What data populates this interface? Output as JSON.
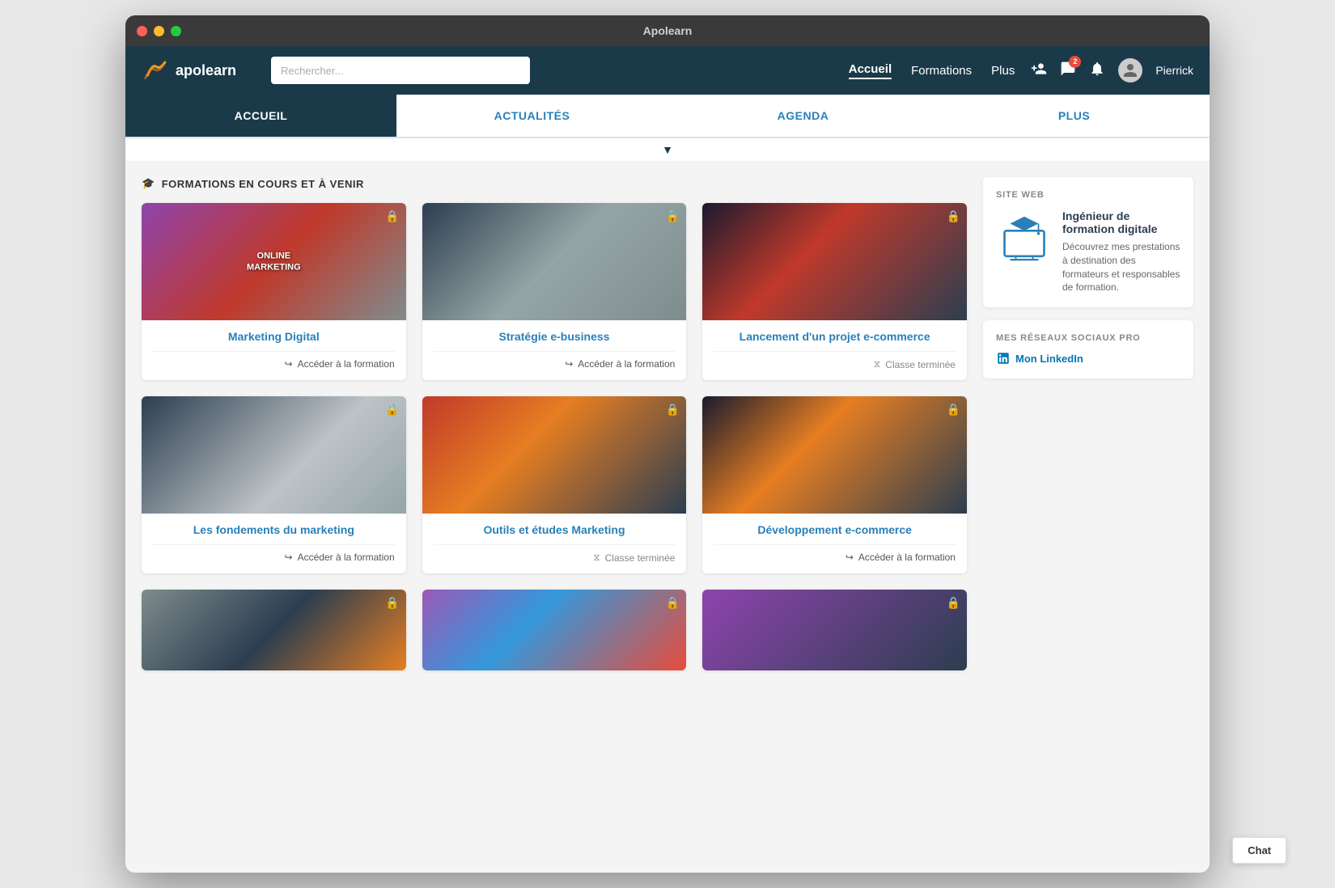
{
  "window": {
    "title": "Apolearn"
  },
  "navbar": {
    "logo_text": "apolearn",
    "search_placeholder": "Rechercher...",
    "links": [
      {
        "label": "Accueil",
        "active": true
      },
      {
        "label": "Formations",
        "active": false
      },
      {
        "label": "Plus",
        "active": false
      }
    ],
    "user_name": "Pierrick",
    "badge_count": "2"
  },
  "tabs": [
    {
      "label": "ACCUEIL",
      "active": true
    },
    {
      "label": "ACTUALITÉS",
      "active": false
    },
    {
      "label": "AGENDA",
      "active": false
    },
    {
      "label": "PLUS",
      "active": false
    }
  ],
  "section_title": "FORMATIONS EN COURS ET À VENIR",
  "courses": [
    {
      "id": 1,
      "title": "Marketing Digital",
      "action": "Accéder à la formation",
      "ended": false,
      "img_class": "img-marketing",
      "overlay": "ONLINE\nMARKETING"
    },
    {
      "id": 2,
      "title": "Stratégie e-business",
      "action": "Accéder à la formation",
      "ended": false,
      "img_class": "img-strategie",
      "overlay": ""
    },
    {
      "id": 3,
      "title": "Lancement d'un projet e-commerce",
      "action": "Classe terminée",
      "ended": true,
      "img_class": "img-lancement",
      "overlay": ""
    },
    {
      "id": 4,
      "title": "Les fondements du marketing",
      "action": "Accéder à la formation",
      "ended": false,
      "img_class": "img-fondements",
      "overlay": ""
    },
    {
      "id": 5,
      "title": "Outils et études Marketing",
      "action": "Classe terminée",
      "ended": true,
      "img_class": "img-outils",
      "overlay": ""
    },
    {
      "id": 6,
      "title": "Développement e-commerce",
      "action": "Accéder à la formation",
      "ended": false,
      "img_class": "img-developpement",
      "overlay": ""
    },
    {
      "id": 7,
      "title": "",
      "action": "",
      "ended": false,
      "img_class": "img-row3-1",
      "overlay": ""
    },
    {
      "id": 8,
      "title": "",
      "action": "",
      "ended": false,
      "img_class": "img-row3-2",
      "overlay": ""
    },
    {
      "id": 9,
      "title": "",
      "action": "",
      "ended": false,
      "img_class": "img-row3-3",
      "overlay": ""
    }
  ],
  "sidebar": {
    "site_web_label": "SITE WEB",
    "promo_title": "Ingénieur de formation digitale",
    "promo_desc": "Découvrez mes prestations à destination des formateurs et responsables de formation.",
    "social_label": "MES RÉSEAUX SOCIAUX PRO",
    "linkedin_text": "Mon LinkedIn"
  },
  "chat_label": "Chat"
}
